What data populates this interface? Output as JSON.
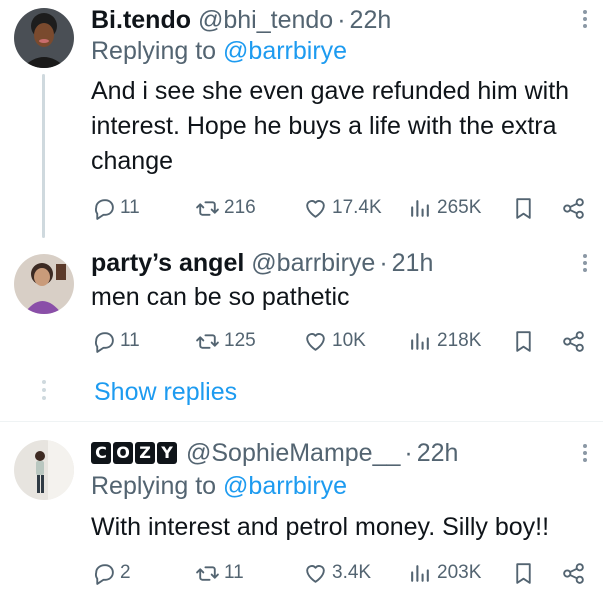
{
  "tweets": [
    {
      "name": "Bi.tendo",
      "handle": "@bhi_tendo",
      "dot": "·",
      "time": "22h",
      "reply_prefix": "Replying to",
      "reply_to": "@barrbirye",
      "text": "And i see she even gave refunded him with interest. Hope he buys a life with the extra change",
      "replies": "11",
      "reposts": "216",
      "likes": "17.4K",
      "views": "265K"
    },
    {
      "name": "party’s angel",
      "handle": "@barrbirye",
      "dot": "·",
      "time": "21h",
      "text": "men can be so pathetic",
      "replies": "11",
      "reposts": "125",
      "likes": "10K",
      "views": "218K"
    },
    {
      "name_badge": [
        "C",
        "O",
        "Z",
        "Y"
      ],
      "handle": "@SophieMampe__",
      "dot": "·",
      "time": "22h",
      "reply_prefix": "Replying to",
      "reply_to": "@barrbirye",
      "text": "With interest and petrol money. Silly boy!!",
      "replies": "2",
      "reposts": "11",
      "likes": "3.4K",
      "views": "203K"
    }
  ],
  "show_replies_label": "Show replies",
  "colors": {
    "accent": "#1d9bf0",
    "secondary_text": "#536471",
    "primary_text": "#0f1419",
    "thread_line": "#cfd9de"
  },
  "icons": [
    "reply-icon",
    "repost-icon",
    "like-icon",
    "views-icon",
    "bookmark-icon",
    "share-icon",
    "more-icon"
  ]
}
